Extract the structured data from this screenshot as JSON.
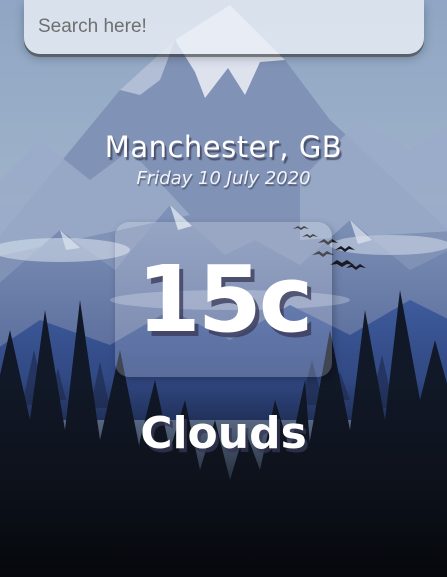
{
  "search": {
    "placeholder": "Search here!",
    "value": ""
  },
  "location": {
    "city": "Manchester, GB"
  },
  "date": {
    "text": "Friday 10 July 2020"
  },
  "weather": {
    "temperature": "15c",
    "condition": "Clouds"
  },
  "icons": {
    "background": "mountain-forest-scene",
    "birds": "birds-icon"
  }
}
